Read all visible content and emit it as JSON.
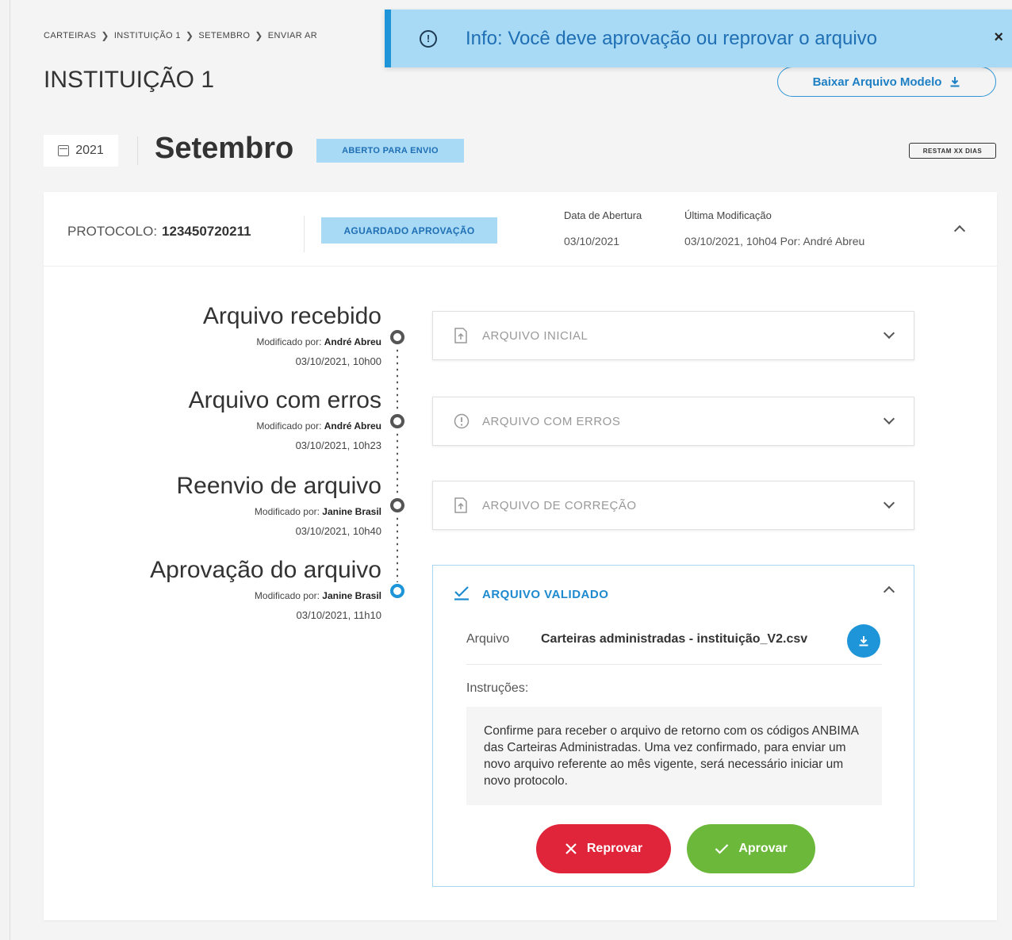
{
  "breadcrumb": {
    "items": [
      "CARTEIRAS",
      "INSTITUIÇÃO 1",
      "SETEMBRO",
      "ENVIAR AR"
    ],
    "separator": "❯"
  },
  "page_title": "INSTITUIÇÃO 1",
  "download_model_label": "Baixar Arquivo Modelo",
  "toast": {
    "message": "Info: Você deve aprovação ou reprovar o arquivo",
    "close": "×"
  },
  "period": {
    "year": "2021",
    "month": "Setembro",
    "status": "ABERTO PARA ENVIO",
    "days_left": "RESTAM XX DIAS"
  },
  "protocol": {
    "label": "PROTOCOLO:",
    "value": "123450720211",
    "status": "AGUARDADO APROVAÇÃO",
    "opened_label": "Data de Abertura",
    "opened_value": "03/10/2021",
    "modified_label": "Última Modificação",
    "modified_value": "03/10/2021, 10h04 Por: André Abreu"
  },
  "timeline": [
    {
      "title": "Arquivo recebido",
      "mod_prefix": "Modificado por:",
      "mod_by": "André Abreu",
      "date": "03/10/2021, 10h00"
    },
    {
      "title": "Arquivo com erros",
      "mod_prefix": "Modificado por:",
      "mod_by": "André Abreu",
      "date": "03/10/2021, 10h23"
    },
    {
      "title": "Reenvio de arquivo",
      "mod_prefix": "Modificado por:",
      "mod_by": "Janine Brasil",
      "date": "03/10/2021, 10h40"
    },
    {
      "title": "Aprovação do arquivo",
      "mod_prefix": "Modificado por:",
      "mod_by": "Janine Brasil",
      "date": "03/10/2021, 11h10"
    }
  ],
  "accordions": [
    {
      "label": "ARQUIVO INICIAL",
      "icon": "file-upload-icon"
    },
    {
      "label": "ARQUIVO COM ERROS",
      "icon": "alert-circle-icon"
    },
    {
      "label": "ARQUIVO DE CORREÇÃO",
      "icon": "file-upload-icon"
    }
  ],
  "validated": {
    "label": "ARQUIVO VALIDADO",
    "file_label": "Arquivo",
    "file_name": "Carteiras administradas -  instituição_V2.csv",
    "instructions_label": "Instruções:",
    "instructions": "Confirme para receber o arquivo de retorno com os códigos ANBIMA das Carteiras Administradas. Uma vez confirmado, para enviar um novo arquivo referente ao mês vigente, será necessário iniciar um novo protocolo.",
    "reject_label": "Reprovar",
    "approve_label": "Aprovar"
  },
  "colors": {
    "accent": "#1d95d8",
    "badge_bg": "#a8daf5",
    "reject": "#e0253a",
    "approve": "#6bb83a"
  }
}
